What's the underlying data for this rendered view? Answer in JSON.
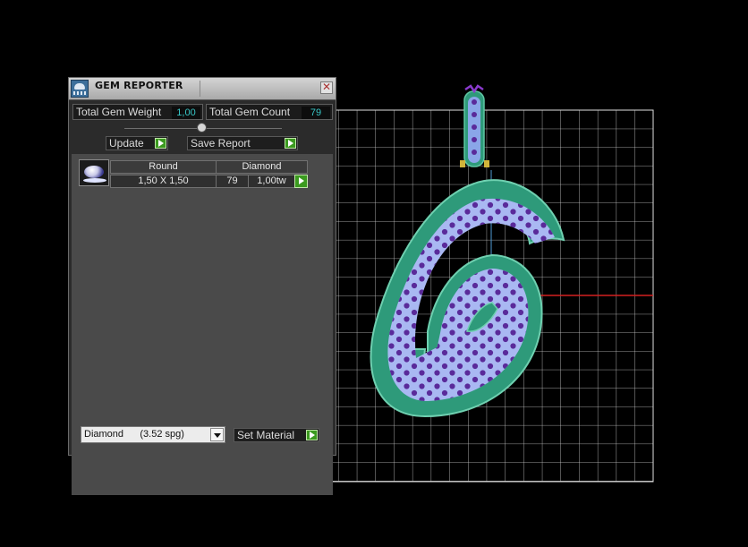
{
  "panel": {
    "title": "GEM REPORTER",
    "close_glyph": "✕",
    "stats": {
      "total_weight_label": "Total Gem Weight",
      "total_weight_value": "1,00",
      "total_count_label": "Total Gem Count",
      "total_count_value": "79"
    },
    "buttons": {
      "update_label": "Update",
      "save_report_label": "Save Report",
      "set_material_label": "Set Material"
    },
    "gem_table": {
      "headers": [
        "Round",
        "Diamond"
      ],
      "rows": [
        {
          "size": "1,50 X 1,50",
          "count": "79",
          "weight": "1,00tw"
        }
      ]
    },
    "material_select": {
      "value": "Diamond      (3.52 spg)"
    }
  },
  "colors": {
    "viewport_background": "#000000",
    "grid_lines": "#d8d8d8",
    "accent_cyan": "#37c6c6",
    "button_arrow": "#3b9a1f",
    "setting_green": "#2e9a7a",
    "gem_fill": "#a9b8f2",
    "stones": "#5a2a9a",
    "axis_red": "#d42020"
  },
  "icons": [
    "gem-reporter-app-icon",
    "close-icon",
    "play-arrow-icon",
    "round-gem-icon",
    "dropdown-arrow-icon"
  ]
}
